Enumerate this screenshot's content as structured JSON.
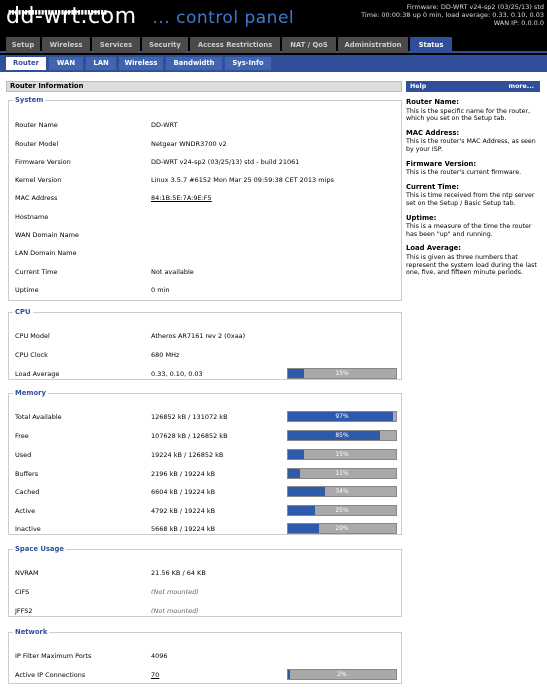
{
  "header": {
    "logo_main": "dd-wrt.com",
    "logo_sub": "... control panel",
    "logo_dots": "▮▮▮▮▮▮▮▮▮▮▮▮▮▮▮▮▮▮▮▮▮▮▮▮▮▮▮▮▮▮",
    "firmware": "Firmware: DD-WRT v24-sp2 (03/25/13) std",
    "time": "Time: 00:00:38 up 0 min, load average: 0.33, 0.10, 0.03",
    "wan_ip": "WAN IP: 0.0.0.0"
  },
  "tabs_primary": [
    "Setup",
    "Wireless",
    "Services",
    "Security",
    "Access Restrictions",
    "NAT / QoS",
    "Administration",
    "Status"
  ],
  "tabs_secondary": [
    "Router",
    "WAN",
    "LAN",
    "Wireless",
    "Bandwidth",
    "Sys-Info"
  ],
  "main_title": "Router Information",
  "sections": {
    "system": {
      "title": "System",
      "rows": [
        {
          "label": "Router Name",
          "value": "DD-WRT"
        },
        {
          "label": "Router Model",
          "value": "Netgear WNDR3700 v2"
        },
        {
          "label": "Firmware Version",
          "value": "DD-WRT v24-sp2 (03/25/13) std - build 21061"
        },
        {
          "label": "Kernel Version",
          "value": "Linux 3.5.7 #6152 Mon Mar 25 09:59:38 CET 2013 mips"
        },
        {
          "label": "MAC Address",
          "value": "84:1B:5E:7A:9E:F5"
        },
        {
          "label": "Hostname",
          "value": ""
        },
        {
          "label": "WAN Domain Name",
          "value": ""
        },
        {
          "label": "LAN Domain Name",
          "value": ""
        },
        {
          "label": "Current Time",
          "value": "Not available"
        },
        {
          "label": "Uptime",
          "value": "0 min"
        }
      ]
    },
    "cpu": {
      "title": "CPU",
      "rows": [
        {
          "label": "CPU Model",
          "value": "Atheros AR7161 rev 2 (0xaa)"
        },
        {
          "label": "CPU Clock",
          "value": "680 MHz"
        },
        {
          "label": "Load Average",
          "value": "0.33, 0.10, 0.03",
          "bar": 15,
          "bar_label": "15%"
        }
      ]
    },
    "memory": {
      "title": "Memory",
      "rows": [
        {
          "label": "Total Available",
          "value": "126852 kB / 131072 kB",
          "bar": 97,
          "bar_label": "97%"
        },
        {
          "label": "Free",
          "value": "107628 kB / 126852 kB",
          "bar": 85,
          "bar_label": "85%"
        },
        {
          "label": "Used",
          "value": "19224 kB / 126852 kB",
          "bar": 15,
          "bar_label": "15%"
        },
        {
          "label": "Buffers",
          "value": "2196 kB / 19224 kB",
          "bar": 11,
          "bar_label": "11%"
        },
        {
          "label": "Cached",
          "value": "6604 kB / 19224 kB",
          "bar": 34,
          "bar_label": "34%"
        },
        {
          "label": "Active",
          "value": "4792 kB / 19224 kB",
          "bar": 25,
          "bar_label": "25%"
        },
        {
          "label": "Inactive",
          "value": "5668 kB / 19224 kB",
          "bar": 29,
          "bar_label": "29%"
        }
      ]
    },
    "space": {
      "title": "Space Usage",
      "rows": [
        {
          "label": "NVRAM",
          "value": "21.56 KB / 64 KB"
        },
        {
          "label": "CIFS",
          "value": "(Not mounted)"
        },
        {
          "label": "JFFS2",
          "value": "(Not mounted)"
        }
      ]
    },
    "network": {
      "title": "Network",
      "rows": [
        {
          "label": "IP Filter Maximum Ports",
          "value": "4096"
        },
        {
          "label": "Active IP Connections",
          "value": "70",
          "bar": 2,
          "bar_label": "2%"
        }
      ]
    }
  },
  "help": {
    "title": "Help",
    "more": "more...",
    "items": [
      {
        "title": "Router Name:",
        "text": "This is the specific name for the router, which you set on the Setup tab."
      },
      {
        "title": "MAC Address:",
        "text": "This is the router's MAC Address, as seen by your ISP."
      },
      {
        "title": "Firmware Version:",
        "text": "This is the router's current firmware."
      },
      {
        "title": "Current Time:",
        "text": "This is time received from the ntp server set on the Setup / Basic Setup tab."
      },
      {
        "title": "Uptime:",
        "text": "This is a measure of the time the router has been \"up\" and running."
      },
      {
        "title": "Load Average:",
        "text": "This is given as three numbers that represent the system load during the last one, five, and fifteen minute periods."
      }
    ]
  }
}
